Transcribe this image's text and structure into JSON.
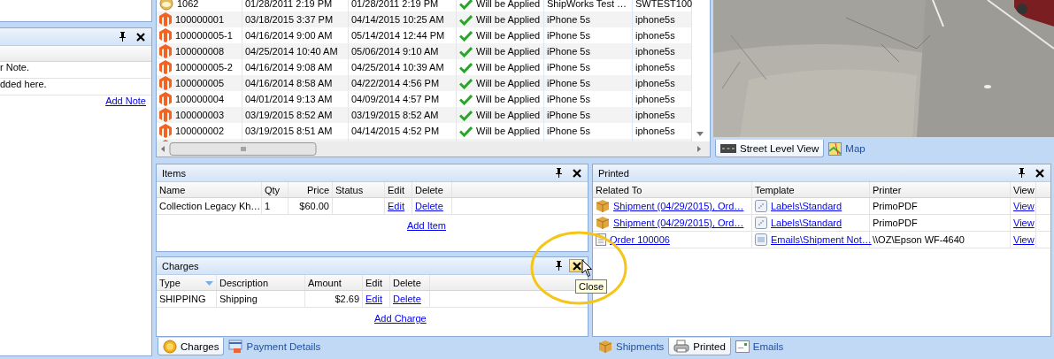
{
  "notes_panel": {
    "lines": [
      "r Note.",
      "dded here."
    ],
    "add_link": "Add Note"
  },
  "orders": {
    "rows": [
      {
        "kind": "coin",
        "cells": [
          "1062",
          "01/28/2011 2:19 PM",
          "01/28/2011 2:19 PM",
          "Will be Applied",
          "ShipWorks Test …",
          "SWTEST100"
        ]
      },
      {
        "kind": "store",
        "cells": [
          "100000001",
          "03/18/2015 3:37 PM",
          "04/14/2015 10:25 AM",
          "Will be Applied",
          "iPhone 5s",
          "iphone5s"
        ]
      },
      {
        "kind": "store",
        "cells": [
          "100000005-1",
          "04/16/2014 9:00 AM",
          "05/14/2014 12:44 PM",
          "Will be Applied",
          "iPhone 5s",
          "iphone5s"
        ]
      },
      {
        "kind": "store",
        "cells": [
          "100000008",
          "04/25/2014 10:40 AM",
          "05/06/2014 9:10 AM",
          "Will be Applied",
          "iPhone 5s",
          "iphone5s"
        ]
      },
      {
        "kind": "store",
        "cells": [
          "100000005-2",
          "04/16/2014 9:08 AM",
          "04/25/2014 10:39 AM",
          "Will be Applied",
          "iPhone 5s",
          "iphone5s"
        ]
      },
      {
        "kind": "store",
        "cells": [
          "100000005",
          "04/16/2014 8:58 AM",
          "04/22/2014 4:56 PM",
          "Will be Applied",
          "iPhone 5s",
          "iphone5s"
        ]
      },
      {
        "kind": "store",
        "cells": [
          "100000004",
          "04/01/2014 9:13 AM",
          "04/09/2014 4:57 PM",
          "Will be Applied",
          "iPhone 5s",
          "iphone5s"
        ]
      },
      {
        "kind": "store",
        "cells": [
          "100000003",
          "03/19/2015 8:52 AM",
          "03/19/2015 8:52 AM",
          "Will be Applied",
          "iPhone 5s",
          "iphone5s"
        ]
      },
      {
        "kind": "store",
        "cells": [
          "100000002",
          "03/19/2015 8:51 AM",
          "04/14/2015 4:52 PM",
          "Will be Applied",
          "iPhone 5s",
          "iphone5s"
        ]
      },
      {
        "kind": "store"
      }
    ]
  },
  "street_view": {
    "tabs": [
      {
        "label": "Street Level View",
        "kind": "road",
        "selected": true
      },
      {
        "label": "Map",
        "kind": "map",
        "selected": false
      }
    ]
  },
  "items": {
    "title": "Items",
    "close_hovered": false,
    "columns": [
      "Name",
      "Qty",
      "Price",
      "Status",
      "Edit",
      "Delete"
    ],
    "rows": [
      {
        "name": "Collection Legacy Kh…",
        "qty": "1",
        "price": "$60.00",
        "edit": "Edit",
        "delete": "Delete"
      }
    ],
    "add_link": "Add Item"
  },
  "charges": {
    "title": "Charges",
    "close_hovered": true,
    "columns": [
      {
        "label": "Type",
        "sorted": true
      },
      {
        "label": "Description",
        "sorted": false
      },
      {
        "label": "Amount",
        "sorted": false
      },
      {
        "label": "Edit",
        "sorted": false
      },
      {
        "label": "Delete",
        "sorted": false
      }
    ],
    "rows": [
      {
        "type": "SHIPPING",
        "description": "Shipping",
        "amount": "$2.69",
        "edit": "Edit",
        "delete": "Delete"
      }
    ],
    "add_link": "Add Charge"
  },
  "charge_tabs": [
    {
      "label": "Charges",
      "kind": "coin",
      "selected": true
    },
    {
      "label": "Payment Details",
      "kind": "card",
      "selected": false
    }
  ],
  "printed": {
    "title": "Printed",
    "close_hovered": false,
    "columns": [
      "Related To",
      "Template",
      "Printer",
      "View"
    ],
    "rows": [
      {
        "kind": "shipment",
        "related": "Shipment (04/29/2015), Ord…",
        "template": "Labels\\Standard",
        "printer": "PrimoPDF",
        "view": "View"
      },
      {
        "kind": "shipment",
        "related": "Shipment (04/29/2015), Ord…",
        "template": "Labels\\Standard",
        "printer": "PrimoPDF",
        "view": "View"
      },
      {
        "kind": "order",
        "related": "Order 100006",
        "template": "Emails\\Shipment Not…",
        "printer": "\\\\OZ\\Epson WF-4640",
        "view": "View"
      }
    ]
  },
  "printed_tabs": [
    {
      "label": "Shipments",
      "kind": "box",
      "selected": false
    },
    {
      "label": "Printed",
      "kind": "printer",
      "selected": true
    },
    {
      "label": "Emails",
      "kind": "window",
      "selected": false
    }
  ],
  "tooltip": {
    "text": "Close"
  }
}
